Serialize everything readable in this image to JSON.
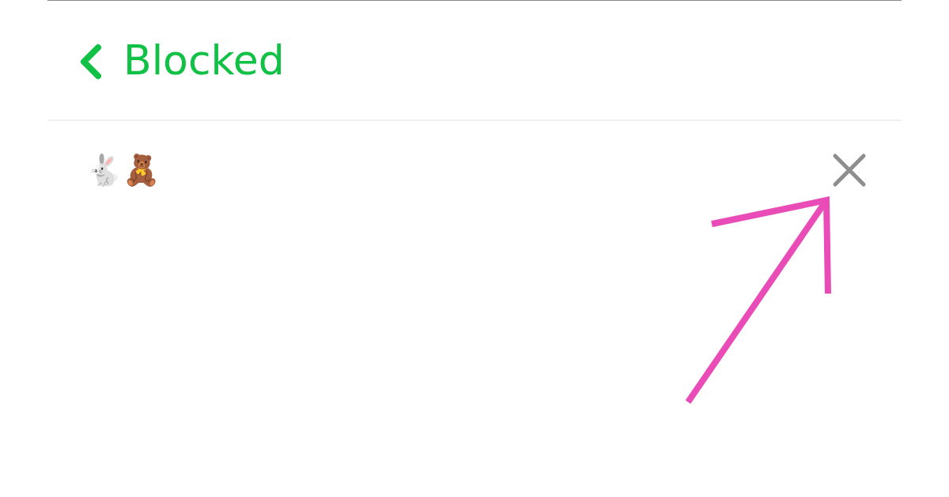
{
  "header": {
    "title": "Blocked"
  },
  "blocked_users": [
    {
      "name": "🐇🧸"
    }
  ],
  "annotation": {
    "kind": "arrow"
  }
}
